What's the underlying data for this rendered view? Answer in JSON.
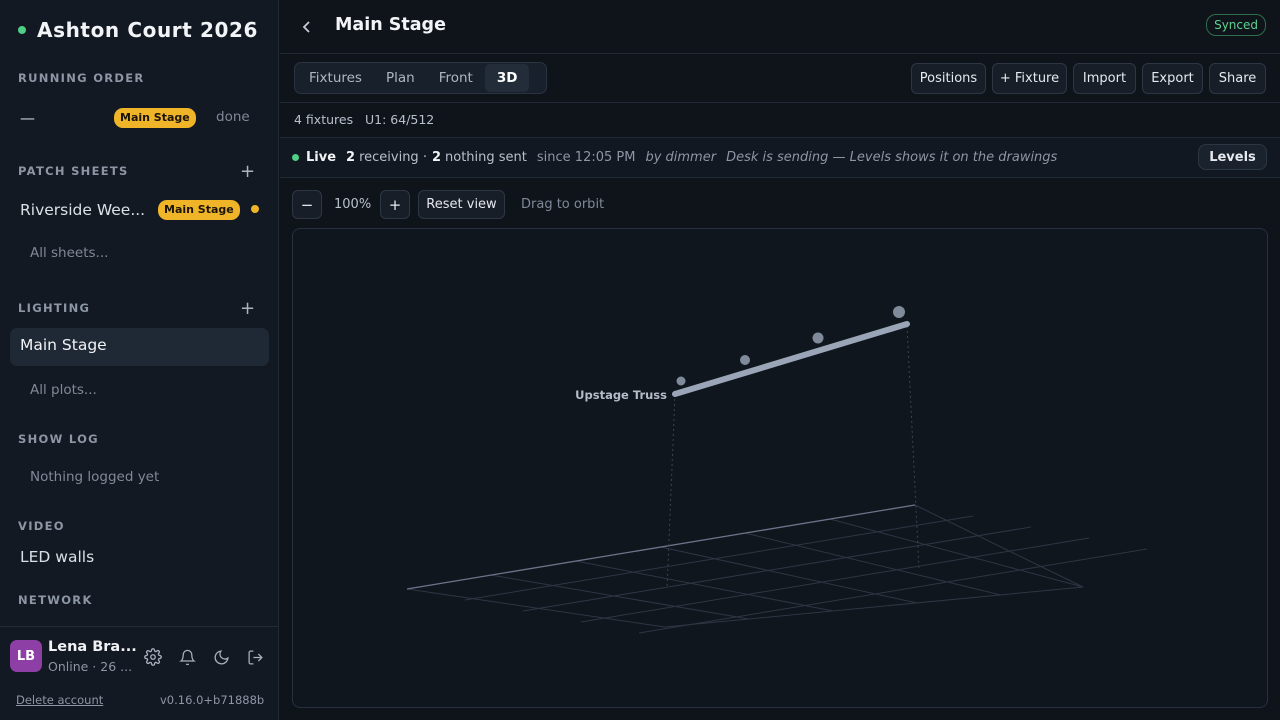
{
  "sidebar": {
    "project_title": "Ashton Court 2026",
    "running_order": {
      "heading": "RUNNING ORDER",
      "item_label": "—",
      "item_badge": "Main Stage",
      "item_status": "done"
    },
    "patch_sheets": {
      "heading": "PATCH SHEETS",
      "item_label": "Riverside Wee...",
      "item_badge": "Main Stage",
      "all_link": "All sheets..."
    },
    "lighting": {
      "heading": "LIGHTING",
      "item_label": "Main Stage",
      "all_link": "All plots..."
    },
    "show_log": {
      "heading": "SHOW LOG",
      "empty_text": "Nothing logged yet"
    },
    "video": {
      "heading": "VIDEO",
      "item_label": "LED walls"
    },
    "network": {
      "heading": "NETWORK"
    },
    "user": {
      "initials": "LB",
      "name": "Lena Bra...",
      "status": "Online · 26 ..."
    },
    "delete_account": "Delete account",
    "version": "v0.16.0+b71888b"
  },
  "header": {
    "back_icon": "chevron-left-icon",
    "title": "Main Stage",
    "sync_status": "Synced"
  },
  "tabs": [
    {
      "label": "Fixtures",
      "active": false
    },
    {
      "label": "Plan",
      "active": false
    },
    {
      "label": "Front",
      "active": false
    },
    {
      "label": "3D",
      "active": true
    }
  ],
  "toolbar": {
    "positions": "Positions",
    "add_fixture": "+ Fixture",
    "import": "Import",
    "export": "Export",
    "share": "Share"
  },
  "counts": {
    "fixtures": "4 fixtures",
    "universe": "U1: 64/512"
  },
  "live": {
    "label": "Live",
    "receiving_count": "2",
    "receiving_text": "receiving ·",
    "nothing_count": "2",
    "nothing_text": "nothing sent",
    "since": "since 12:05 PM",
    "by": "by dimmer",
    "message": "Desk is sending — Levels shows it on the drawings",
    "levels_button": "Levels"
  },
  "zoom": {
    "minus": "−",
    "level": "100%",
    "plus": "+",
    "reset": "Reset view",
    "hint": "Drag to orbit"
  },
  "scene": {
    "truss_label": "Upstage Truss",
    "fixture_count": 4
  },
  "colors": {
    "accent_green": "#4fcf85",
    "badge_amber": "#f0b429",
    "truss": "#9aa6b8",
    "fixture": "#7f8a9b"
  }
}
